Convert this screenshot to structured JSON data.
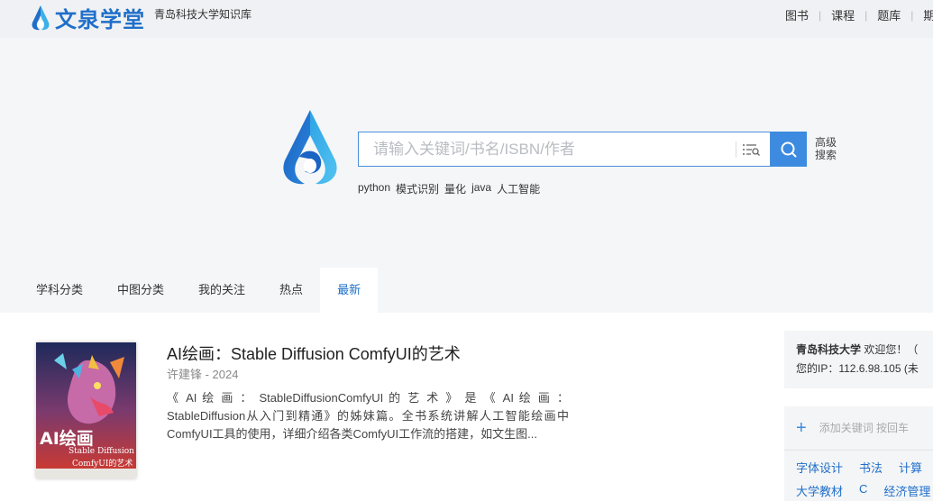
{
  "header": {
    "logo_text": "文泉学堂",
    "library_name": "青岛科技大学知识库",
    "nav": [
      "图书",
      "课程",
      "题库",
      "期刊"
    ]
  },
  "search": {
    "placeholder": "请输入关键词/书名/ISBN/作者",
    "advanced_label": "高级搜索",
    "hot_keywords": [
      "python",
      "模式识别",
      "量化",
      "java",
      "人工智能"
    ]
  },
  "tabs": [
    {
      "label": "学科分类",
      "active": false
    },
    {
      "label": "中图分类",
      "active": false
    },
    {
      "label": "我的关注",
      "active": false
    },
    {
      "label": "热点",
      "active": false
    },
    {
      "label": "最新",
      "active": true
    }
  ],
  "book": {
    "title": "AI绘画：Stable Diffusion ComfyUI的艺术",
    "meta": "许建锋 - 2024",
    "description": "《 AI 绘 画 ： StableDiffusionComfyUI 的 艺 术 》 是 《 AI 绘 画 ： StableDiffusion从入门到精通》的姊妹篇。全书系统讲解人工智能绘画中ComfyUI工具的使用，详细介绍各类ComfyUI工作流的搭建，如文生图...",
    "cover": {
      "big_text": "AI绘画",
      "line1": "Stable Diffusion",
      "line2": "ComfyUI的艺术"
    }
  },
  "side": {
    "school": "青岛科技大学",
    "welcome": " 欢迎您！（",
    "ip_label": "您的IP：112.6.98.105 (未"
  },
  "keywords_panel": {
    "add_label": "添加关键词 按回车",
    "row1": [
      "字体设计",
      "书法",
      "计算"
    ],
    "row2": [
      "大学教材",
      "C",
      "经济管理"
    ]
  },
  "colors": {
    "brand_blue": "#1f6fc9",
    "search_button": "#3c8be0",
    "header_bg": "#f0f1f4",
    "page_bg": "#f5f6f8"
  }
}
